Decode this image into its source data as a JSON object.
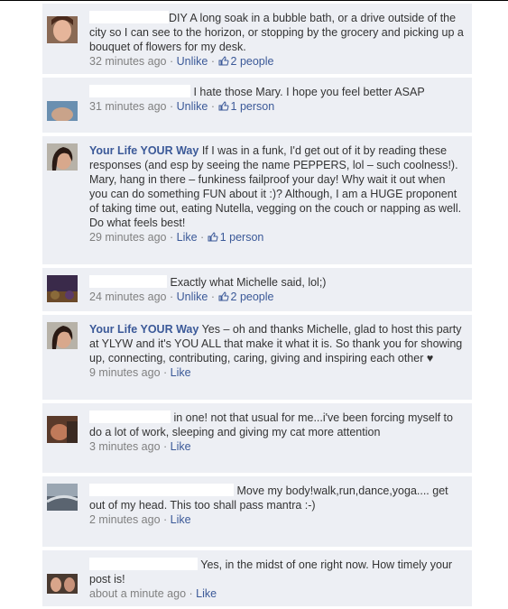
{
  "comments": [
    {
      "author": "",
      "name_prefix": "DIY",
      "text": "A long soak in a bubble bath, or a drive outside of the city so I can see to the horizon, or stopping by the grocery and picking up a bouquet of flowers for my desk.",
      "time": "32 minutes ago",
      "action": "Unlike",
      "likes": "2 people"
    },
    {
      "author": "",
      "text": "I hate those Mary. I hope you feel better ASAP",
      "time": "31 minutes ago",
      "action": "Unlike",
      "likes": "1 person"
    },
    {
      "author": "Your Life YOUR Way",
      "text": "If I was in a funk, I'd get out of it by reading these responses (and esp by seeing the name PEPPERS, lol – such coolness!). Mary, hang in there – funkiness failproof your day! Why wait it out when you can do something FUN about it :)? Although, I am a HUGE proponent of taking time out, eating Nutella, vegging on the couch or napping as well. Do what feels best!",
      "time": "29 minutes ago",
      "action": "Like",
      "likes": "1 person"
    },
    {
      "author": "",
      "text": "Exactly what Michelle said, lol;)",
      "time": "24 minutes ago",
      "action": "Unlike",
      "likes": "2 people"
    },
    {
      "author": "Your Life YOUR Way",
      "text": "Yes – oh and thanks Michelle, glad to host this party at YLYW and it's YOU ALL that make it what it is. So thank you for showing up, connecting, contributing, caring, giving and inspiring each other ♥",
      "time": "9 minutes ago",
      "action": "Like",
      "likes": ""
    },
    {
      "author": "",
      "text": "in one! not that usual for me...i've been forcing myself to do a lot of work, sleeping and giving my cat more attention",
      "time": "3 minutes ago",
      "action": "Like",
      "likes": ""
    },
    {
      "author": "",
      "text": "Move my body!walk,run,dance,yoga.... get out of my head. This too shall pass mantra :-)",
      "time": "2 minutes ago",
      "action": "Like",
      "likes": ""
    },
    {
      "author": "",
      "text": "Yes, in the midst of one right now. How timely your post is!",
      "time": "about a minute ago",
      "action": "Like",
      "likes": ""
    }
  ],
  "separator": "·",
  "colors": {
    "card": "#edeff4",
    "link": "#3b5998",
    "meta": "#808080"
  }
}
